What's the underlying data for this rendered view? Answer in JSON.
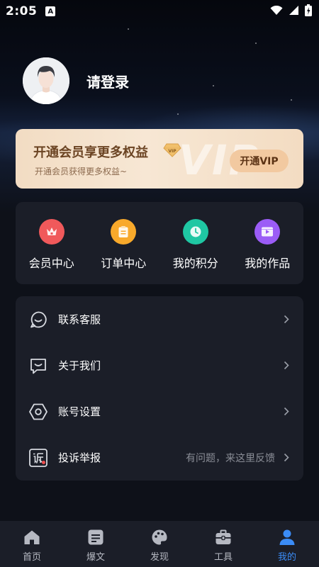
{
  "status_bar": {
    "time": "2:05",
    "notification_badge": "A"
  },
  "profile": {
    "login_text": "请登录"
  },
  "vip_card": {
    "title": "开通会员享更多权益",
    "subtitle": "开通会员获得更多权益~",
    "watermark": "VIP",
    "diamond_label": "VIP",
    "button_label": "开通VIP"
  },
  "quick_actions": [
    {
      "label": "会员中心",
      "icon": "crown-icon",
      "color": "#f0595b"
    },
    {
      "label": "订单中心",
      "icon": "clipboard-icon",
      "color": "#f8a92b"
    },
    {
      "label": "我的积分",
      "icon": "clock-icon",
      "color": "#1fc7a3"
    },
    {
      "label": "我的作品",
      "icon": "video-icon",
      "color": "#9b5cf6"
    }
  ],
  "menu": [
    {
      "label": "联系客服",
      "icon": "chat-bubble-icon",
      "hint": ""
    },
    {
      "label": "关于我们",
      "icon": "message-box-icon",
      "hint": ""
    },
    {
      "label": "账号设置",
      "icon": "hexagon-settings-icon",
      "hint": ""
    },
    {
      "label": "投诉举报",
      "icon": "report-icon",
      "hint": "有问题，来这里反馈"
    }
  ],
  "bottom_nav": [
    {
      "label": "首页",
      "icon": "home-icon",
      "active": false
    },
    {
      "label": "爆文",
      "icon": "article-icon",
      "active": false
    },
    {
      "label": "发现",
      "icon": "palette-icon",
      "active": false
    },
    {
      "label": "工具",
      "icon": "toolbox-icon",
      "active": false
    },
    {
      "label": "我的",
      "icon": "user-icon",
      "active": true
    }
  ],
  "colors": {
    "accent": "#3b8cf6",
    "vip_button": "#f2c9a0",
    "panel": "#1b1e28"
  }
}
